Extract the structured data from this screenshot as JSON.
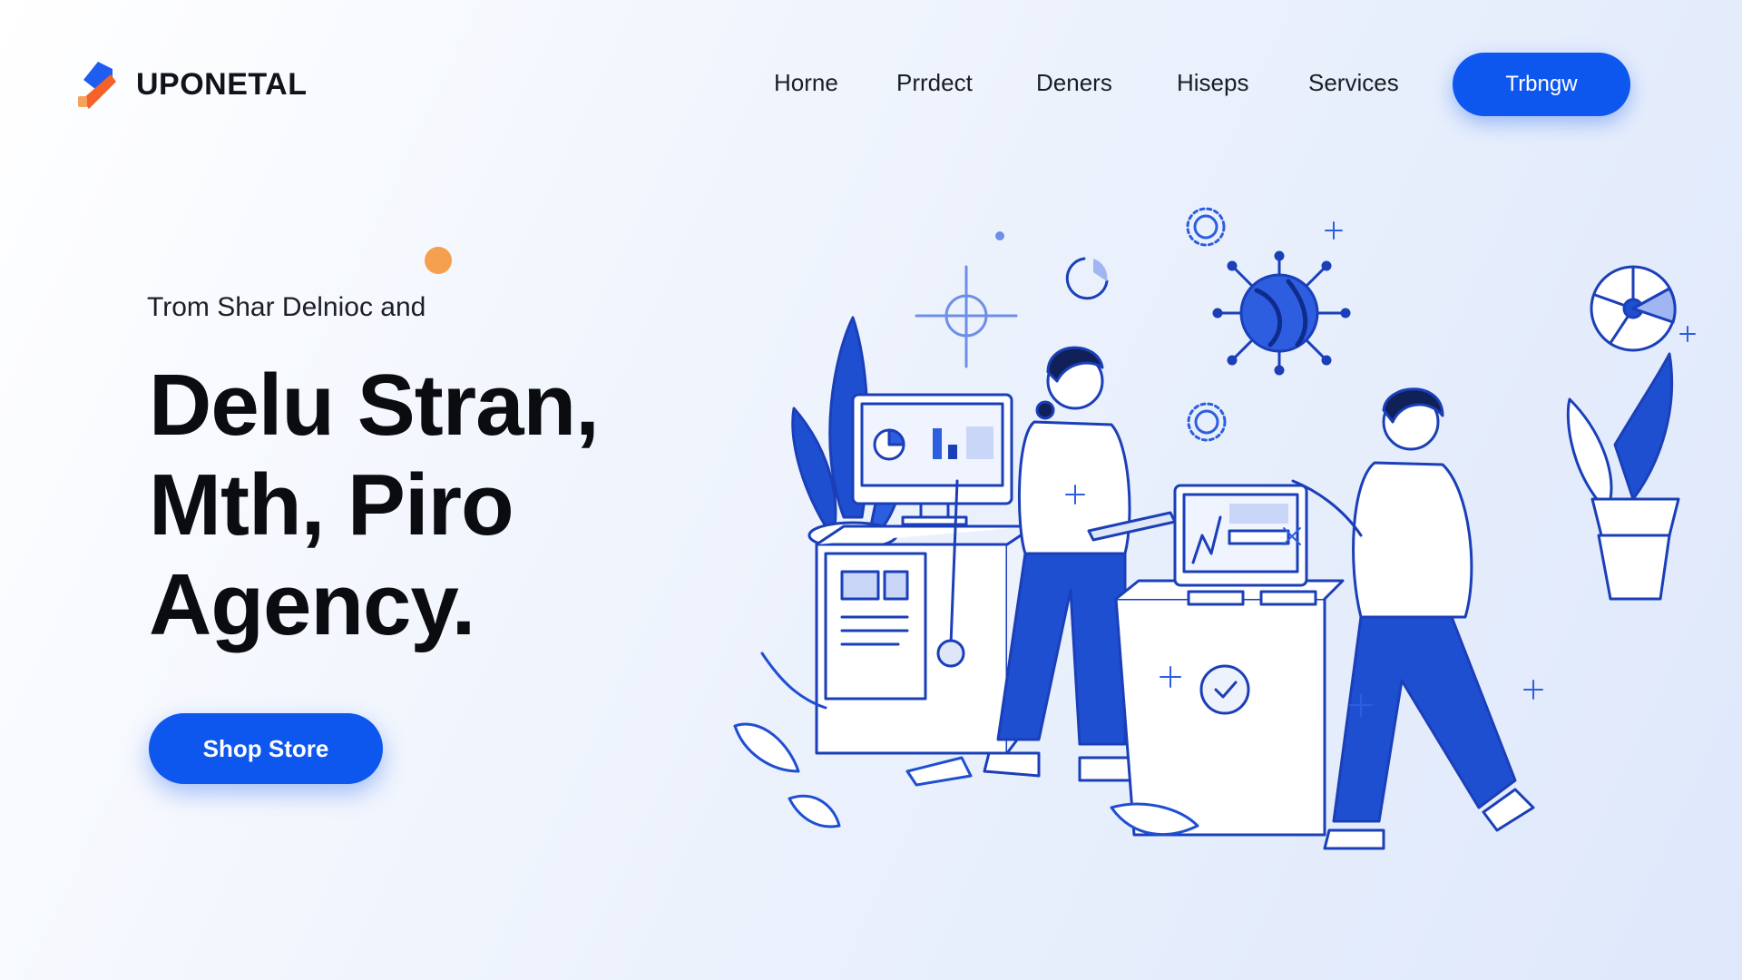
{
  "brand": {
    "name": "UPONETAL",
    "accent": "#0d57ef",
    "logo_orange": "#f4622a",
    "dot_color": "#f5a04e"
  },
  "nav": {
    "items": [
      {
        "label": "Horne"
      },
      {
        "label": "Prrdect"
      },
      {
        "label": "Deners"
      },
      {
        "label": "Hiseps"
      },
      {
        "label": "Services"
      }
    ],
    "cta_label": "Trbngw"
  },
  "hero": {
    "eyebrow": "Trom Shar Delnioc and",
    "headline": [
      "Delu Stran,",
      "Mth, Piro",
      "Agency."
    ],
    "cta_label": "Shop Store"
  },
  "illustration": {
    "icons": [
      "globe-icon",
      "gear-icon",
      "pie-chart-icon",
      "monitor-icon",
      "plant-icon",
      "sparkle-icon"
    ]
  }
}
